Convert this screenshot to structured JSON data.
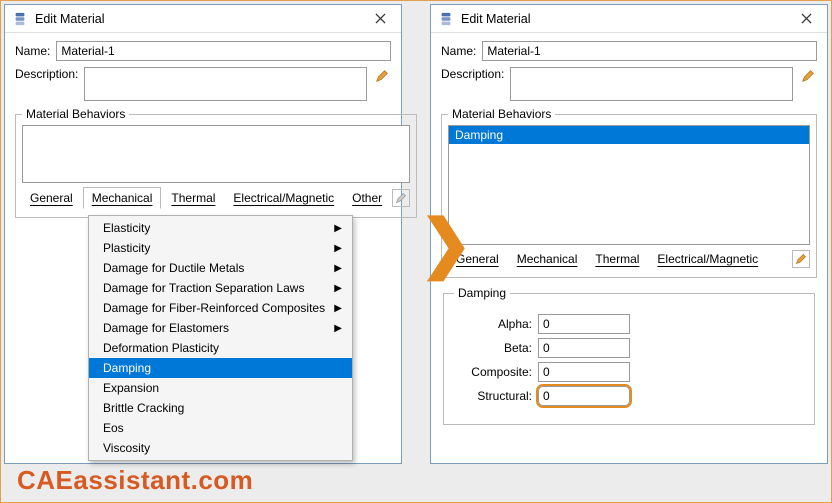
{
  "dialog_title": "Edit Material",
  "labels": {
    "name": "Name:",
    "description": "Description:",
    "behaviors": "Material Behaviors",
    "damping_group": "Damping"
  },
  "name_value": "Material-1",
  "description_value": "",
  "left": {
    "behaviors_selected": null,
    "tabs": [
      "General",
      "Mechanical",
      "Thermal",
      "Electrical/Magnetic",
      "Other"
    ],
    "active_tab": "Mechanical",
    "menu": {
      "items": [
        {
          "label": "Elasticity",
          "submenu": true
        },
        {
          "label": "Plasticity",
          "submenu": true
        },
        {
          "label": "Damage for Ductile Metals",
          "submenu": true
        },
        {
          "label": "Damage for Traction Separation Laws",
          "submenu": true
        },
        {
          "label": "Damage for Fiber-Reinforced Composites",
          "submenu": true
        },
        {
          "label": "Damage for Elastomers",
          "submenu": true
        },
        {
          "label": "Deformation Plasticity",
          "submenu": false
        },
        {
          "label": "Damping",
          "submenu": false,
          "highlighted": true
        },
        {
          "label": "Expansion",
          "submenu": false
        },
        {
          "label": "Brittle Cracking",
          "submenu": false
        },
        {
          "label": "Eos",
          "submenu": false
        },
        {
          "label": "Viscosity",
          "submenu": false
        }
      ]
    }
  },
  "right": {
    "behaviors_list": [
      "Damping"
    ],
    "tabs": [
      "General",
      "Mechanical",
      "Thermal",
      "Electrical/Magnetic"
    ],
    "fields": [
      {
        "label": "Alpha:",
        "value": "0"
      },
      {
        "label": "Beta:",
        "value": "0"
      },
      {
        "label": "Composite:",
        "value": "0"
      },
      {
        "label": "Structural:",
        "value": "0",
        "highlighted": true
      }
    ]
  },
  "watermark": "CAEassistant.com",
  "arrow_glyph": "❯"
}
